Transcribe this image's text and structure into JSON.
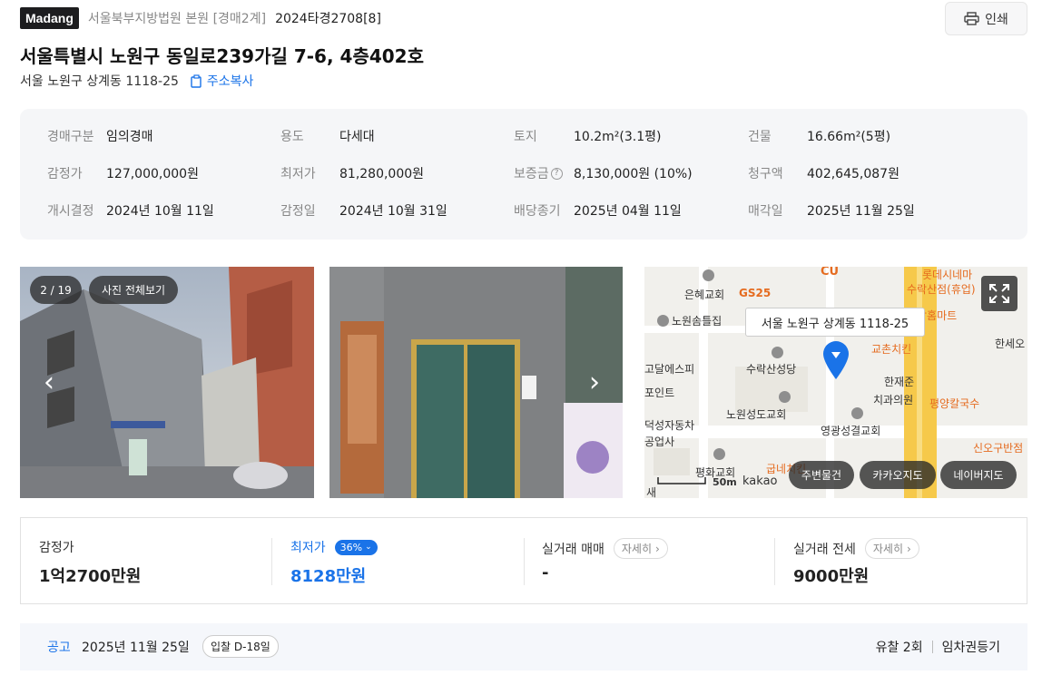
{
  "header": {
    "logo": "Madang",
    "court": "서울북부지방법원 본원 [경매2계]",
    "case_number": "2024타경2708[8]",
    "print_label": "인쇄",
    "address": "서울특별시 노원구 동일로239가길 7-6, 4층402호",
    "lot_address": "서울 노원구 상계동 1118-25",
    "copy_label": "주소복사"
  },
  "info": {
    "type_label": "경매구분",
    "type_value": "임의경매",
    "use_label": "용도",
    "use_value": "다세대",
    "land_label": "토지",
    "land_value": "10.2m²(3.1평)",
    "building_label": "건물",
    "building_value": "16.66m²(5평)",
    "appraisal_label": "감정가",
    "appraisal_value": "127,000,000원",
    "minimum_label": "최저가",
    "minimum_value": "81,280,000원",
    "deposit_label": "보증금",
    "deposit_value": "8,130,000원 (10%)",
    "claim_label": "청구액",
    "claim_value": "402,645,087원",
    "start_label": "개시결정",
    "start_value": "2024년 10월 11일",
    "appraisal_date_label": "감정일",
    "appraisal_date_value": "2024년 10월 31일",
    "dividend_label": "배당종기",
    "dividend_value": "2025년 04월 11일",
    "sale_label": "매각일",
    "sale_value": "2025년 11월 25일"
  },
  "photos": {
    "counter": "2 / 19",
    "view_all": "사진 전체보기"
  },
  "map": {
    "address_label": "서울 노원구 상계동 1118-25",
    "labels": {
      "cu": "CU",
      "lotte": "롯데시네마",
      "suraksan": "수락산점(휴업)",
      "eunhye": "은혜교회",
      "gs25": "GS25",
      "nowon_somteul": "노원솜틀집",
      "homemart": "락홈마트",
      "hanse": "한세오",
      "gyochon": "교촌치킨",
      "godal": "고달에스피",
      "suraksan_church": "수락산성당",
      "point": "포인트",
      "hanjaejun": "한재준",
      "dental": "치과의원",
      "pyeongyang": "평양칼국수",
      "deokseong": "덕성자동차",
      "gongeopsa": "공업사",
      "nowon_seongdo": "노원성도교회",
      "younggwang": "영광성결교회",
      "sinogu": "신오구반점",
      "pyeonghwa": "평화교회",
      "gubne": "굽네치킨",
      "sae": "새",
      "scale": "50m",
      "brand": "kakao"
    },
    "btn_nearby": "주변물건",
    "btn_kakao": "카카오지도",
    "btn_naver": "네이버지도"
  },
  "summary": {
    "appraisal_label": "감정가",
    "appraisal_value": "1억2700만원",
    "minimum_label": "최저가",
    "minimum_badge": "36%",
    "minimum_value": "8128만원",
    "trade_label": "실거래 매매",
    "trade_detail": "자세히",
    "trade_value": "-",
    "rent_label": "실거래 전세",
    "rent_detail": "자세히",
    "rent_value": "9000만원"
  },
  "notice": {
    "label": "공고",
    "date": "2025년 11월 25일",
    "dday": "입찰 D-18일",
    "fail_count": "유찰 2회",
    "lease_reg": "임차권등기"
  },
  "colors": {
    "accent": "#1a73e8",
    "logo_bg": "#1d1d1f",
    "map_road": "#f6c94a",
    "map_pin": "#1a73e8"
  }
}
